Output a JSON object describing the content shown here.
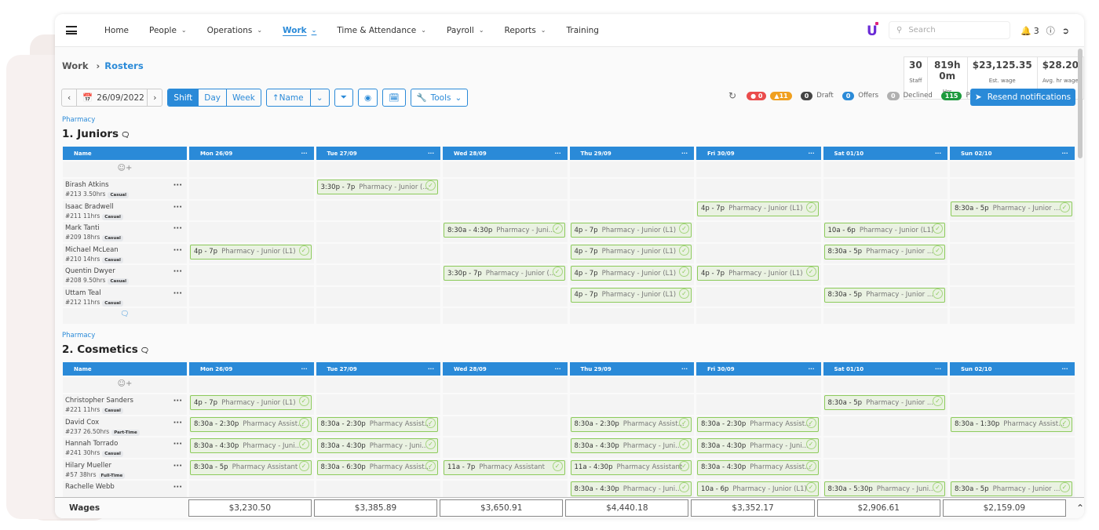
{
  "nav": {
    "items": [
      {
        "label": "Home",
        "dd": false
      },
      {
        "label": "People",
        "dd": true
      },
      {
        "label": "Operations",
        "dd": true
      },
      {
        "label": "Work",
        "dd": true,
        "active": true
      },
      {
        "label": "Time & Attendance",
        "dd": true
      },
      {
        "label": "Payroll",
        "dd": true
      },
      {
        "label": "Reports",
        "dd": true
      },
      {
        "label": "Training",
        "dd": false
      }
    ],
    "logo": "U",
    "search_placeholder": "Search",
    "notif_count": "3"
  },
  "breadcrumb": {
    "parent": "Work",
    "current": "Rosters"
  },
  "stats": [
    {
      "value": "30",
      "label": "Staff"
    },
    {
      "value": "819h 0m",
      "label": "Hrs"
    },
    {
      "value": "$23,125.35",
      "label": "Est. wage"
    },
    {
      "value": "$28.20",
      "label": "Avg. hr wage"
    }
  ],
  "toolbar": {
    "date": "26/09/2022",
    "views": [
      "Shift",
      "Day",
      "Week"
    ],
    "active_view": "Shift",
    "sort": "Name",
    "tools": "Tools"
  },
  "status": {
    "errors": "0",
    "warnings": "11",
    "draft": "0",
    "draft_label": "Draft",
    "offers": "0",
    "offers_label": "Offers",
    "declined": "0",
    "declined_label": "Declined",
    "published": "115",
    "published_label": "Published",
    "colors": {
      "error": "#ea4c4c",
      "warning": "#f0a020",
      "draft": "#444444",
      "offers": "#2a8ad8",
      "declined": "#b0b0b0",
      "published": "#1e9a3e"
    }
  },
  "resend_label": "Resend notifications",
  "name_header": "Name",
  "days": [
    "Mon 26/09",
    "Tue 27/09",
    "Wed 28/09",
    "Thu 29/09",
    "Fri 30/09",
    "Sat 01/10",
    "Sun 02/10"
  ],
  "sections": [
    {
      "tag": "Pharmacy",
      "title": "1. Juniors",
      "rows": [
        {
          "name": "Birash Atkins",
          "id": "#213",
          "hrs": "3.50hrs",
          "type": "Casual",
          "shifts": [
            null,
            {
              "time": "3:30p - 7p",
              "role": "Pharmacy - Junior (..."
            },
            null,
            null,
            null,
            null,
            null
          ]
        },
        {
          "name": "Isaac Bradwell",
          "id": "#211",
          "hrs": "11hrs",
          "type": "Casual",
          "shifts": [
            null,
            null,
            null,
            null,
            {
              "time": "4p - 7p",
              "role": "Pharmacy - Junior (L1)"
            },
            null,
            {
              "time": "8:30a - 5p",
              "role": "Pharmacy - Junior ..."
            }
          ]
        },
        {
          "name": "Mark Tanti",
          "id": "#209",
          "hrs": "18hrs",
          "type": "Casual",
          "shifts": [
            null,
            null,
            {
              "time": "8:30a - 4:30p",
              "role": "Pharmacy - Juni..."
            },
            {
              "time": "4p - 7p",
              "role": "Pharmacy - Junior (L1)"
            },
            null,
            {
              "time": "10a - 6p",
              "role": "Pharmacy - Junior (L1)"
            },
            null
          ]
        },
        {
          "name": "Michael McLean",
          "id": "#210",
          "hrs": "14hrs",
          "type": "Casual",
          "shifts": [
            {
              "time": "4p - 7p",
              "role": "Pharmacy - Junior (L1)"
            },
            null,
            null,
            {
              "time": "4p - 7p",
              "role": "Pharmacy - Junior (L1)"
            },
            null,
            {
              "time": "8:30a - 5p",
              "role": "Pharmacy - Junior ..."
            },
            null
          ]
        },
        {
          "name": "Quentin Dwyer",
          "id": "#208",
          "hrs": "9.50hrs",
          "type": "Casual",
          "shifts": [
            null,
            null,
            {
              "time": "3:30p - 7p",
              "role": "Pharmacy - Junior (..."
            },
            {
              "time": "4p - 7p",
              "role": "Pharmacy - Junior (L1)"
            },
            {
              "time": "4p - 7p",
              "role": "Pharmacy - Junior (L1)"
            },
            null,
            null
          ]
        },
        {
          "name": "Uttam Teal",
          "id": "#212",
          "hrs": "11hrs",
          "type": "Casual",
          "shifts": [
            null,
            null,
            null,
            {
              "time": "4p - 7p",
              "role": "Pharmacy - Junior (L1)"
            },
            null,
            {
              "time": "8:30a - 5p",
              "role": "Pharmacy - Junior ..."
            },
            null
          ]
        }
      ]
    },
    {
      "tag": "Pharmacy",
      "title": "2. Cosmetics",
      "rows": [
        {
          "name": "Christopher Sanders",
          "id": "#221",
          "hrs": "11hrs",
          "type": "Casual",
          "shifts": [
            {
              "time": "4p - 7p",
              "role": "Pharmacy - Junior (L1)"
            },
            null,
            null,
            null,
            null,
            {
              "time": "8:30a - 5p",
              "role": "Pharmacy - Junior ..."
            },
            null
          ]
        },
        {
          "name": "David Cox",
          "id": "#237",
          "hrs": "26.50hrs",
          "type": "Part-Time",
          "shifts": [
            {
              "time": "8:30a - 2:30p",
              "role": "Pharmacy Assist..."
            },
            {
              "time": "8:30a - 2:30p",
              "role": "Pharmacy Assist..."
            },
            null,
            {
              "time": "8:30a - 2:30p",
              "role": "Pharmacy Assist..."
            },
            {
              "time": "8:30a - 2:30p",
              "role": "Pharmacy Assist..."
            },
            null,
            {
              "time": "8:30a - 1:30p",
              "role": "Pharmacy Assist..."
            }
          ]
        },
        {
          "name": "Hannah Torrado",
          "id": "#241",
          "hrs": "30hrs",
          "type": "Casual",
          "shifts": [
            {
              "time": "8:30a - 4:30p",
              "role": "Pharmacy - Juni..."
            },
            {
              "time": "8:30a - 4:30p",
              "role": "Pharmacy - Juni..."
            },
            null,
            {
              "time": "8:30a - 4:30p",
              "role": "Pharmacy - Juni..."
            },
            {
              "time": "8:30a - 4:30p",
              "role": "Pharmacy - Juni..."
            },
            null,
            null
          ]
        },
        {
          "name": "Hilary Mueller",
          "id": "#57",
          "hrs": "38hrs",
          "type": "Full-Time",
          "shifts": [
            {
              "time": "8:30a - 5p",
              "role": "Pharmacy Assistant"
            },
            {
              "time": "8:30a - 6:30p",
              "role": "Pharmacy Assist..."
            },
            {
              "time": "11a - 7p",
              "role": "Pharmacy Assistant"
            },
            {
              "time": "11a - 4:30p",
              "role": "Pharmacy Assistant"
            },
            {
              "time": "8:30a - 4:30p",
              "role": "Pharmacy Assist..."
            },
            null,
            null
          ]
        },
        {
          "name": "Rachelle Webb",
          "id": "",
          "hrs": "",
          "type": "",
          "shifts": [
            null,
            null,
            null,
            {
              "time": "8:30a - 4:30p",
              "role": "Pharmacy - Juni..."
            },
            {
              "time": "10a - 6p",
              "role": "Pharmacy - Junior (L1)"
            },
            {
              "time": "8:30a - 5:30p",
              "role": "Pharmacy - Juni..."
            },
            {
              "time": "8:30a - 5p",
              "role": "Pharmacy - Junior ..."
            }
          ]
        }
      ]
    }
  ],
  "wages": {
    "label": "Wages",
    "values": [
      "$3,230.50",
      "$3,385.89",
      "$3,650.91",
      "$4,440.18",
      "$3,352.17",
      "$2,906.61",
      "$2,159.09"
    ]
  }
}
